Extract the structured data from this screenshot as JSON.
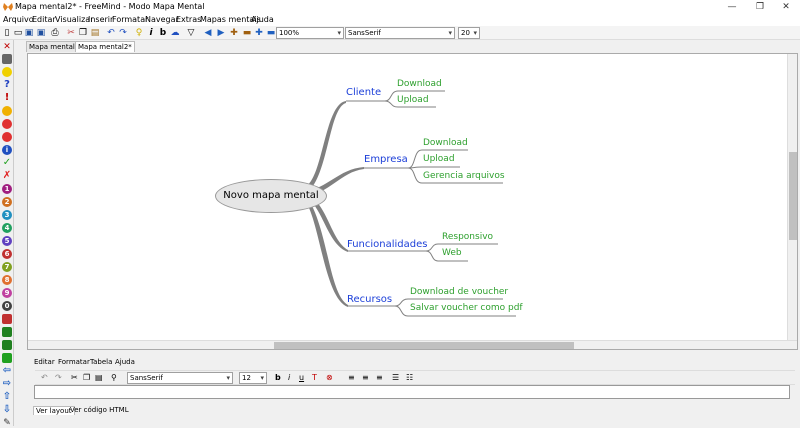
{
  "window": {
    "title": "Mapa mental2* - FreeMind - Modo Mapa Mental",
    "buttons": {
      "minimize": "—",
      "restore": "❐",
      "close": "✕"
    }
  },
  "menu": [
    "Arquivo",
    "Editar",
    "Visualizar",
    "Inserir",
    "Formatar",
    "Navegar",
    "Extras",
    "Mapas mentais",
    "Ajuda"
  ],
  "toolbar": {
    "zoom": "100%",
    "font": "SansSerif",
    "size": "20"
  },
  "tabs": [
    "Mapa mental1*",
    "Mapa mental2*"
  ],
  "map": {
    "root": "Novo mapa mental",
    "branches": [
      {
        "label": "Cliente",
        "children": [
          "Download",
          "Upload"
        ]
      },
      {
        "label": "Empresa",
        "children": [
          "Download",
          "Upload",
          "Gerencia arquivos"
        ]
      },
      {
        "label": "Funcionalidades",
        "children": [
          "Responsivo",
          "Web"
        ]
      },
      {
        "label": "Recursos",
        "children": [
          "Download de voucher",
          "Salvar voucher como pdf"
        ]
      }
    ],
    "colors": {
      "branch": "#1c3fd8",
      "leaf": "#2ea02e",
      "connector": "#808080"
    }
  },
  "editor": {
    "menu": [
      "Editar",
      "Formatar",
      "Tabela",
      "Ajuda"
    ],
    "font": "SansSerif",
    "size": "12",
    "tabs": [
      "Ver layout",
      "Ver código HTML"
    ]
  }
}
